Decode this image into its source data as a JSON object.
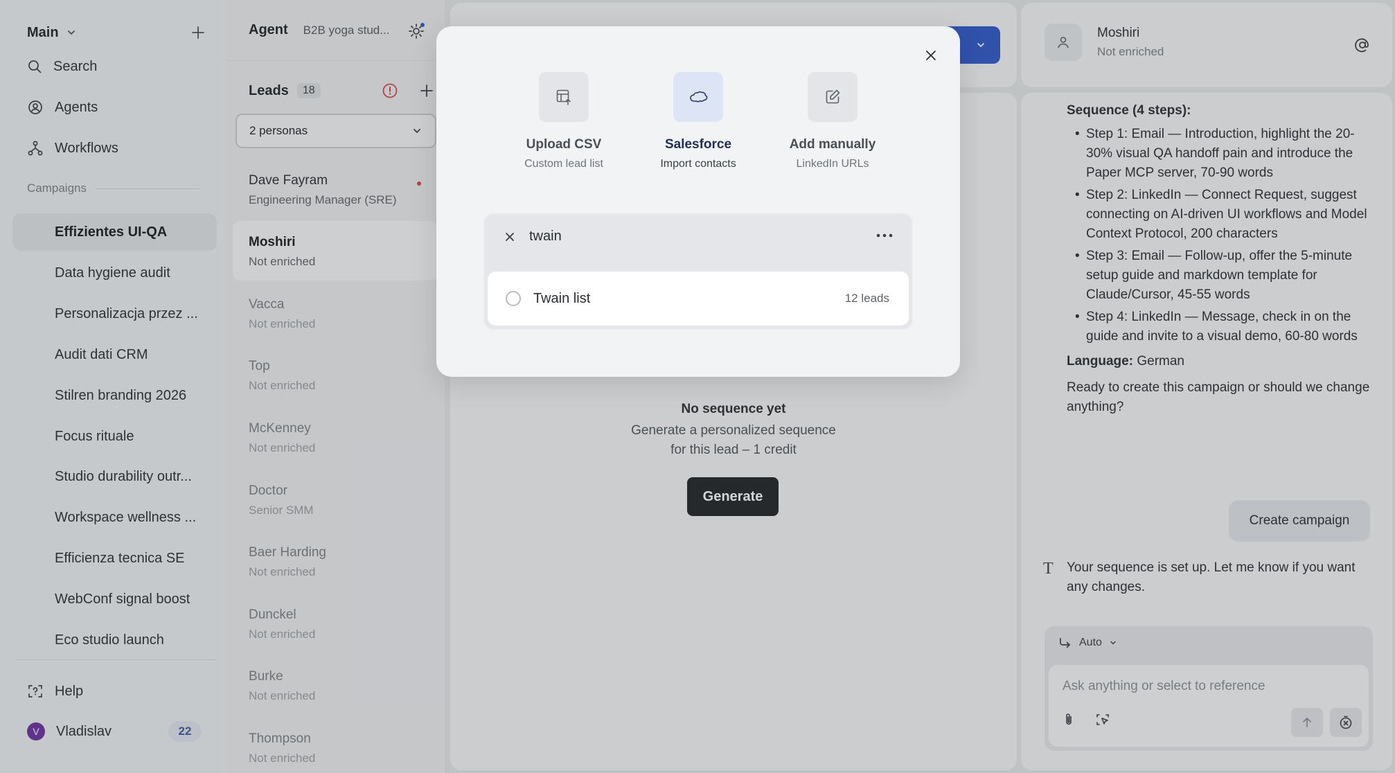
{
  "sidebar": {
    "workspace": "Main",
    "nav": [
      {
        "label": "Search",
        "icon": "search-icon"
      },
      {
        "label": "Agents",
        "icon": "agents-icon"
      },
      {
        "label": "Workflows",
        "icon": "workflows-icon"
      }
    ],
    "campaigns_label": "Campaigns",
    "campaigns": [
      "Effizientes UI-QA",
      "Data hygiene audit",
      "Personalizacja przez ...",
      "Audit dati CRM",
      "Stilren branding 2026",
      "Focus rituale",
      "Studio durability outr...",
      "Workspace wellness ...",
      "Efficienza tecnica SE",
      "WebConf signal boost",
      "Eco studio launch"
    ],
    "help": "Help",
    "user": {
      "initial": "V",
      "name": "Vladislav",
      "badge": "22"
    }
  },
  "leads": {
    "agent_label": "Agent",
    "agent_name": "B2B yoga stud...",
    "title": "Leads",
    "count": "18",
    "persona_filter": "2 personas",
    "items": [
      {
        "name": "Dave Fayram",
        "sub": "Engineering Manager (SRE)"
      },
      {
        "name": "Moshiri",
        "sub": "Not enriched"
      },
      {
        "name": "Vacca",
        "sub": "Not enriched"
      },
      {
        "name": "Top",
        "sub": "Not enriched"
      },
      {
        "name": "McKenney",
        "sub": "Not enriched"
      },
      {
        "name": "Doctor",
        "sub": "Senior SMM"
      },
      {
        "name": "Baer Harding",
        "sub": "Not enriched"
      },
      {
        "name": "Dunckel",
        "sub": "Not enriched"
      },
      {
        "name": "Burke",
        "sub": "Not enriched"
      },
      {
        "name": "Thompson",
        "sub": "Not enriched"
      }
    ]
  },
  "center": {
    "empty_title": "No sequence yet",
    "empty_desc_1": "Generate a personalized sequence",
    "empty_desc_2": "for this lead – 1 credit",
    "generate": "Generate"
  },
  "contact": {
    "name": "Moshiri",
    "status": "Not enriched"
  },
  "chat": {
    "sequence_heading": "Sequence (4 steps):",
    "steps": [
      "Step 1: Email — Introduction, highlight the 20-30% visual QA handoff pain and introduce the Paper MCP server, 70-90 words",
      "Step 2: LinkedIn — Connect Request, suggest connecting on AI-driven UI workflows and Model Context Protocol, 200 characters",
      "Step 3: Email — Follow-up, offer the 5-minute setup guide and markdown template for Claude/Cursor, 45-55 words",
      "Step 4: LinkedIn — Message, check in on the guide and invite to a visual demo, 60-80 words"
    ],
    "language_label": "Language:",
    "language_value": "German",
    "question": "Ready to create this campaign or should we change anything?",
    "user_reply": "Create campaign",
    "assistant_reply": "Your sequence is set up. Let me know if you want any changes.",
    "mode": "Auto",
    "placeholder": "Ask anything or select to reference"
  },
  "modal": {
    "sources": [
      {
        "label": "Upload CSV",
        "sub": "Custom lead list",
        "icon": "table-upload-icon"
      },
      {
        "label": "Salesforce",
        "sub": "Import contacts",
        "icon": "salesforce-cloud-icon"
      },
      {
        "label": "Add manually",
        "sub": "LinkedIn URLs",
        "icon": "edit-icon"
      }
    ],
    "search_value": "twain",
    "list_name": "Twain list",
    "list_count": "12 leads"
  },
  "colors": {
    "accent": "#2f58c9",
    "badge_bg": "#dfe5f0",
    "alert": "#d64545"
  }
}
